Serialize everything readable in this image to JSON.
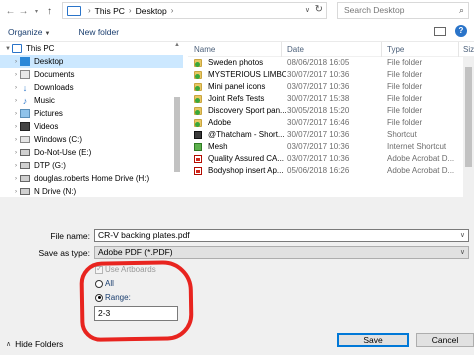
{
  "address": {
    "crumbs": [
      "This PC",
      "Desktop"
    ],
    "search_placeholder": "Search Desktop"
  },
  "toolbar": {
    "organize_label": "Organize",
    "new_folder_label": "New folder"
  },
  "nav": {
    "items": [
      {
        "label": "This PC",
        "icon": "pc-icon"
      },
      {
        "label": "Desktop",
        "icon": "desktop-icon"
      },
      {
        "label": "Documents",
        "icon": "documents-icon"
      },
      {
        "label": "Downloads",
        "icon": "downloads-icon"
      },
      {
        "label": "Music",
        "icon": "music-icon"
      },
      {
        "label": "Pictures",
        "icon": "pictures-icon"
      },
      {
        "label": "Videos",
        "icon": "videos-icon"
      },
      {
        "label": "Windows (C:)",
        "icon": "drive-icon"
      },
      {
        "label": "Do-Not-Use (E:)",
        "icon": "network-drive-icon"
      },
      {
        "label": "DTP (G:)",
        "icon": "network-drive-icon"
      },
      {
        "label": "douglas.roberts Home Drive (H:)",
        "icon": "network-drive-icon"
      },
      {
        "label": "N Drive (N:)",
        "icon": "network-drive-icon"
      }
    ]
  },
  "files": {
    "columns": {
      "name": "Name",
      "date": "Date",
      "type": "Type",
      "size": "Siz"
    },
    "rows": [
      {
        "name": "Sweden photos",
        "date": "08/06/2018 16:05",
        "type": "File folder",
        "icon": "folder-sync-icon"
      },
      {
        "name": "MYSTERIOUS LIMBO",
        "date": "30/07/2017 10:36",
        "type": "File folder",
        "icon": "folder-sync-icon"
      },
      {
        "name": "Mini panel icons",
        "date": "03/07/2017 10:36",
        "type": "File folder",
        "icon": "folder-sync-icon"
      },
      {
        "name": "Joint Refs Tests",
        "date": "30/07/2017 15:38",
        "type": "File folder",
        "icon": "folder-sync-icon"
      },
      {
        "name": "Discovery Sport pan...",
        "date": "30/05/2018 15:20",
        "type": "File folder",
        "icon": "folder-sync-icon"
      },
      {
        "name": "Adobe",
        "date": "30/07/2017 16:46",
        "type": "File folder",
        "icon": "folder-sync-icon"
      },
      {
        "name": "@Thatcham - Short...",
        "date": "30/07/2017 10:36",
        "type": "Shortcut",
        "icon": "shortcut-icon"
      },
      {
        "name": "Mesh",
        "date": "03/07/2017 10:36",
        "type": "Internet Shortcut",
        "icon": "internet-shortcut-icon"
      },
      {
        "name": "Quality Assured CA...",
        "date": "03/07/2017 10:36",
        "type": "Adobe Acrobat D...",
        "icon": "pdf-icon"
      },
      {
        "name": "Bodyshop insert Ap...",
        "date": "05/06/2018 16:26",
        "type": "Adobe Acrobat D...",
        "icon": "pdf-icon"
      }
    ]
  },
  "save": {
    "filename_label": "File name:",
    "filename_value": "CR-V backing plates.pdf",
    "type_label": "Save as type:",
    "type_value": "Adobe PDF (*.PDF)",
    "use_artboards_label": "Use Artboards",
    "all_label": "All",
    "range_label": "Range:",
    "range_value": "2-3",
    "hide_folders_label": "Hide Folders",
    "save_button": "Save",
    "cancel_button": "Cancel"
  },
  "colors": {
    "selection": "#cce8ff",
    "annotation": "#e8241f",
    "accent": "#0078d7"
  }
}
